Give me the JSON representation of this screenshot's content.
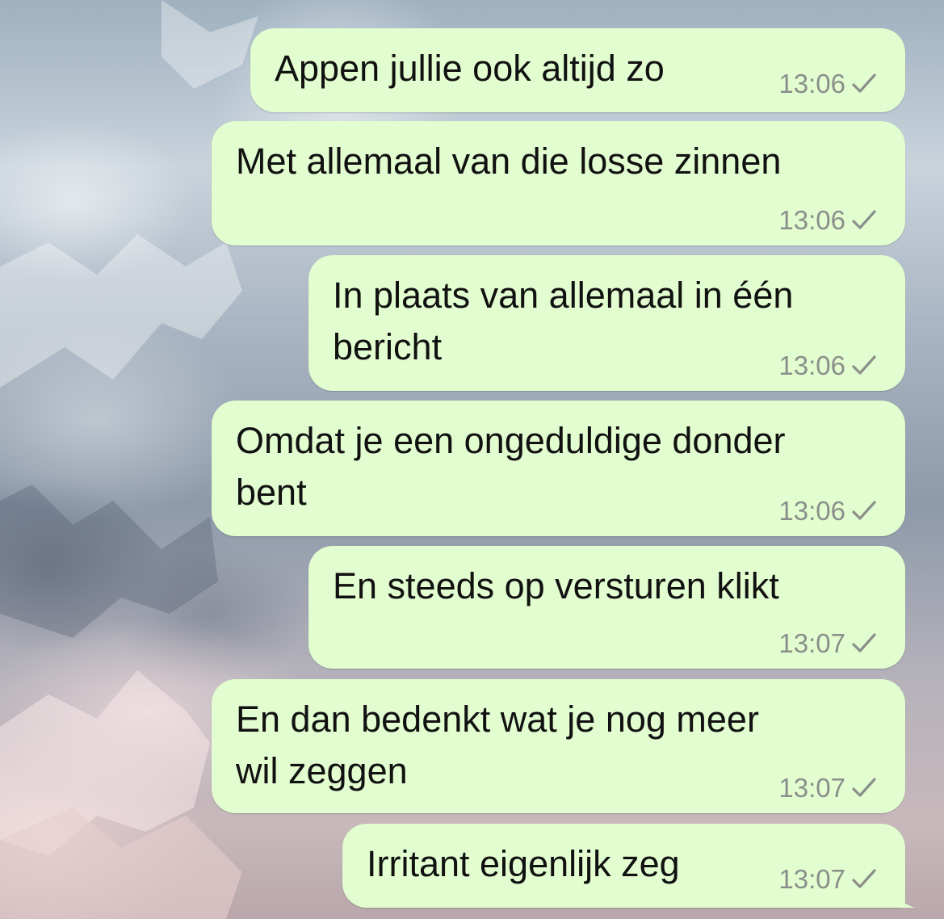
{
  "messages": [
    {
      "text": "Appen jullie ook altijd zo",
      "time": "13:06",
      "status": "sent"
    },
    {
      "text": "Met allemaal van die losse zinnen",
      "time": "13:06",
      "status": "sent"
    },
    {
      "text": "In plaats van allemaal in één\nbericht",
      "time": "13:06",
      "status": "sent"
    },
    {
      "text": "Omdat je een ongeduldige donder\nbent",
      "time": "13:06",
      "status": "sent"
    },
    {
      "text": "En steeds op versturen klikt",
      "time": "13:07",
      "status": "sent"
    },
    {
      "text": "En dan bedenkt wat je nog meer\nwil zeggen",
      "time": "13:07",
      "status": "sent"
    },
    {
      "text": "Irritant eigenlijk zeg",
      "time": "13:07",
      "status": "sent"
    }
  ],
  "colors": {
    "outgoing_bubble": "#e2fdcf",
    "timestamp": "#8a8f8a",
    "message_text": "#111111"
  },
  "icons": {
    "status": "check-icon",
    "background": "mountain-wallpaper"
  }
}
